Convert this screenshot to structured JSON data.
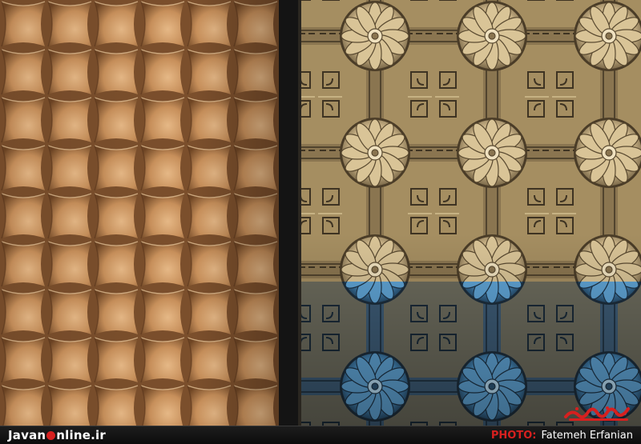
{
  "footer": {
    "brand_first": "Javan",
    "brand_second": "nline.ir",
    "credit_label": "PHOTO:",
    "credit_name": "Fatemeh Erfanian"
  },
  "colors": {
    "terracotta": "#c9905c",
    "terracotta_shadow": "#6e4524",
    "brass": "#b8a173",
    "brass_dark": "#3e3322",
    "turquoise": "#4a90c4",
    "divider": "#141414",
    "brand_red": "#d6201f"
  },
  "icons": {
    "stamp": "javanonline-stamp-logo"
  }
}
